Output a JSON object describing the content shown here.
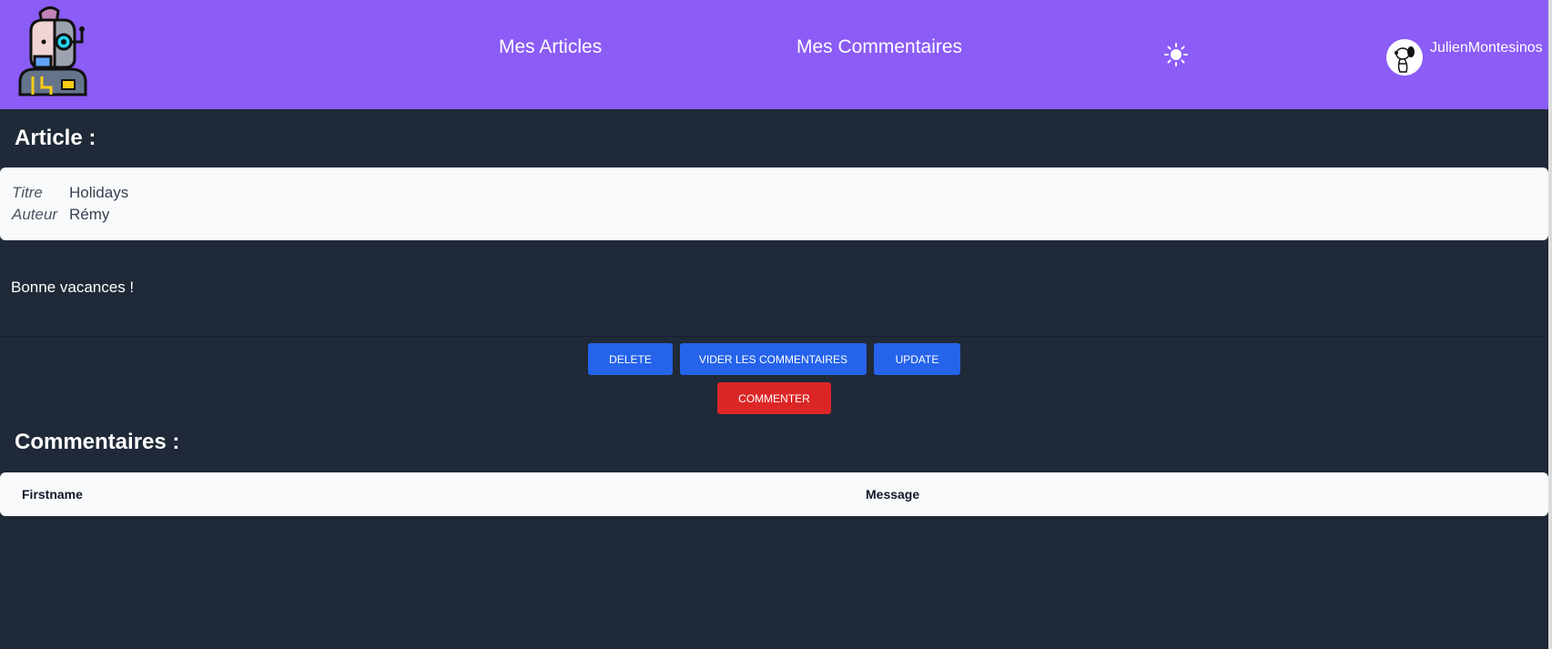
{
  "navbar": {
    "logo_icon": "robot-logo-icon",
    "links": [
      "Mes Articles",
      "Mes Commentaires"
    ],
    "theme_icon": "sun-icon",
    "user": {
      "avatar_icon": "snoopy-avatar-icon",
      "name": "JulienMontesinos"
    },
    "accent_color": "#8b5cf6"
  },
  "article": {
    "heading": "Article :",
    "title_label": "Titre",
    "title_value": "Holidays",
    "author_label": "Auteur",
    "author_value": "Rémy",
    "body": "Bonne vacances !"
  },
  "actions": {
    "delete_label": "DELETE",
    "clear_label": "VIDER LES COMMENTAIRES",
    "update_label": "UPDATE",
    "comment_label": "COMMENTER",
    "primary_color": "#2563eb",
    "danger_color": "#dc2626"
  },
  "comments": {
    "heading": "Commentaires :",
    "columns": [
      "Firstname",
      "Message"
    ]
  },
  "background_color": "#1f2937"
}
